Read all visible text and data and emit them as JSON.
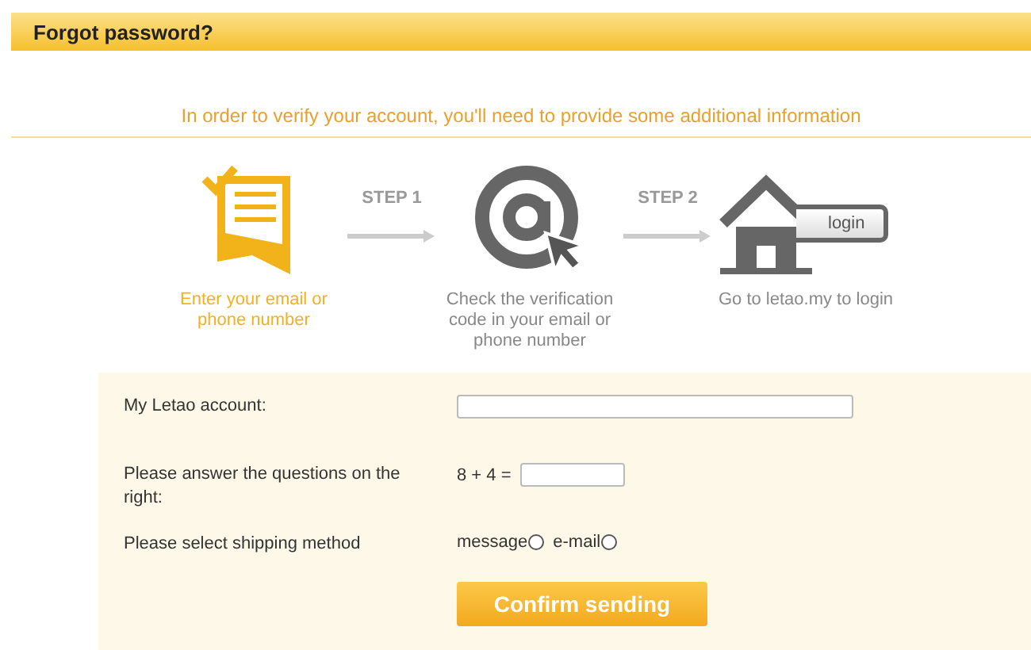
{
  "title": "Forgot password?",
  "intro": "In order to verify your account, you'll need to provide some additional information",
  "steps": [
    {
      "kind": "document",
      "caption": "Enter your email or phone number",
      "selected": true
    },
    {
      "kind": "at",
      "caption": "Check the verification code in your email or phone number",
      "selected": false
    },
    {
      "kind": "house",
      "caption": "Go to letao.my to login",
      "selected": false,
      "badge": "login"
    }
  ],
  "connectors": [
    "STEP 1",
    "STEP 2"
  ],
  "form": {
    "rows": [
      {
        "kind": "text",
        "label": "My Letao account:"
      },
      {
        "kind": "captcha",
        "label": "Please answer the questions on the right:",
        "question": "8 + 4 ="
      },
      {
        "kind": "radio",
        "label": "Please select shipping method",
        "options": [
          {
            "label": "message",
            "selected": false
          },
          {
            "label": "e-mail",
            "selected": false
          }
        ]
      }
    ],
    "button": "Confirm sending"
  }
}
